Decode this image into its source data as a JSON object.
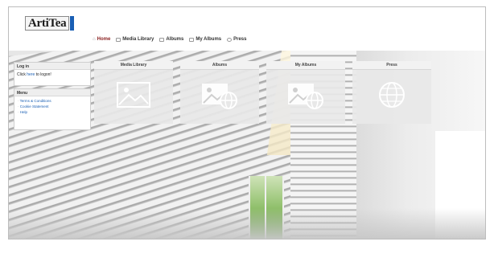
{
  "header": {
    "logo_text": "ArtiTea"
  },
  "nav": {
    "items": [
      {
        "label": "Home",
        "icon": "home-icon",
        "active": true
      },
      {
        "label": "Media Library",
        "icon": "media-icon",
        "active": false
      },
      {
        "label": "Albums",
        "icon": "albums-icon",
        "active": false
      },
      {
        "label": "My Albums",
        "icon": "my-albums-icon",
        "active": false
      },
      {
        "label": "Press",
        "icon": "press-icon",
        "active": false
      }
    ]
  },
  "sidebar": {
    "login": {
      "title": "Log in",
      "text_before": "Click ",
      "link": "here",
      "text_after": " to logon!"
    },
    "menu": {
      "title": "Menu",
      "items": [
        "Terms & Conditions",
        "Cookie Statement",
        "Help"
      ]
    }
  },
  "tiles": [
    {
      "title": "Media Library",
      "icon": "image-icon"
    },
    {
      "title": "Albums",
      "icon": "image-globe-icon"
    },
    {
      "title": "My Albums",
      "icon": "image-globe-icon"
    },
    {
      "title": "Press",
      "icon": "globe-icon"
    }
  ],
  "colors": {
    "brand_blue": "#1a5fb4",
    "active_nav": "#8a1f1f"
  }
}
